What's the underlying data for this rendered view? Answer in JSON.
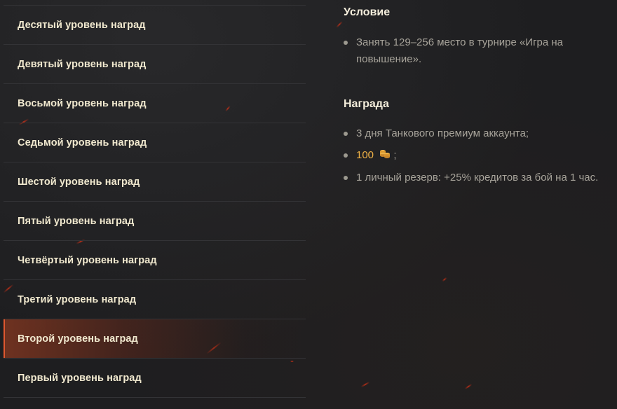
{
  "reward_levels": [
    {
      "label": "Десятый уровень наград",
      "active": false
    },
    {
      "label": "Девятый уровень наград",
      "active": false
    },
    {
      "label": "Восьмой уровень наград",
      "active": false
    },
    {
      "label": "Седьмой уровень наград",
      "active": false
    },
    {
      "label": "Шестой уровень наград",
      "active": false
    },
    {
      "label": "Пятый уровень наград",
      "active": false
    },
    {
      "label": "Четвёртый уровень наград",
      "active": false
    },
    {
      "label": "Третий уровень наград",
      "active": false
    },
    {
      "label": "Второй уровень наград",
      "active": true
    },
    {
      "label": "Первый уровень наград",
      "active": false
    }
  ],
  "condition": {
    "title": "Условие",
    "items": [
      "Занять 129–256 место в турнире «Игра на повышение»."
    ]
  },
  "reward": {
    "title": "Награда",
    "items": {
      "premium": "3 дня Танкового премиум аккаунта;",
      "gold_value": "100",
      "gold_suffix": ";",
      "gold_icon": "gold-coins-icon",
      "reserve": "1 личный резерв: +25% кредитов за бой на 1 час."
    }
  },
  "colors": {
    "accent": "#e0582f",
    "gold": "#f0b246",
    "label": "#f1e9cf",
    "body_text": "#a7a39a"
  }
}
